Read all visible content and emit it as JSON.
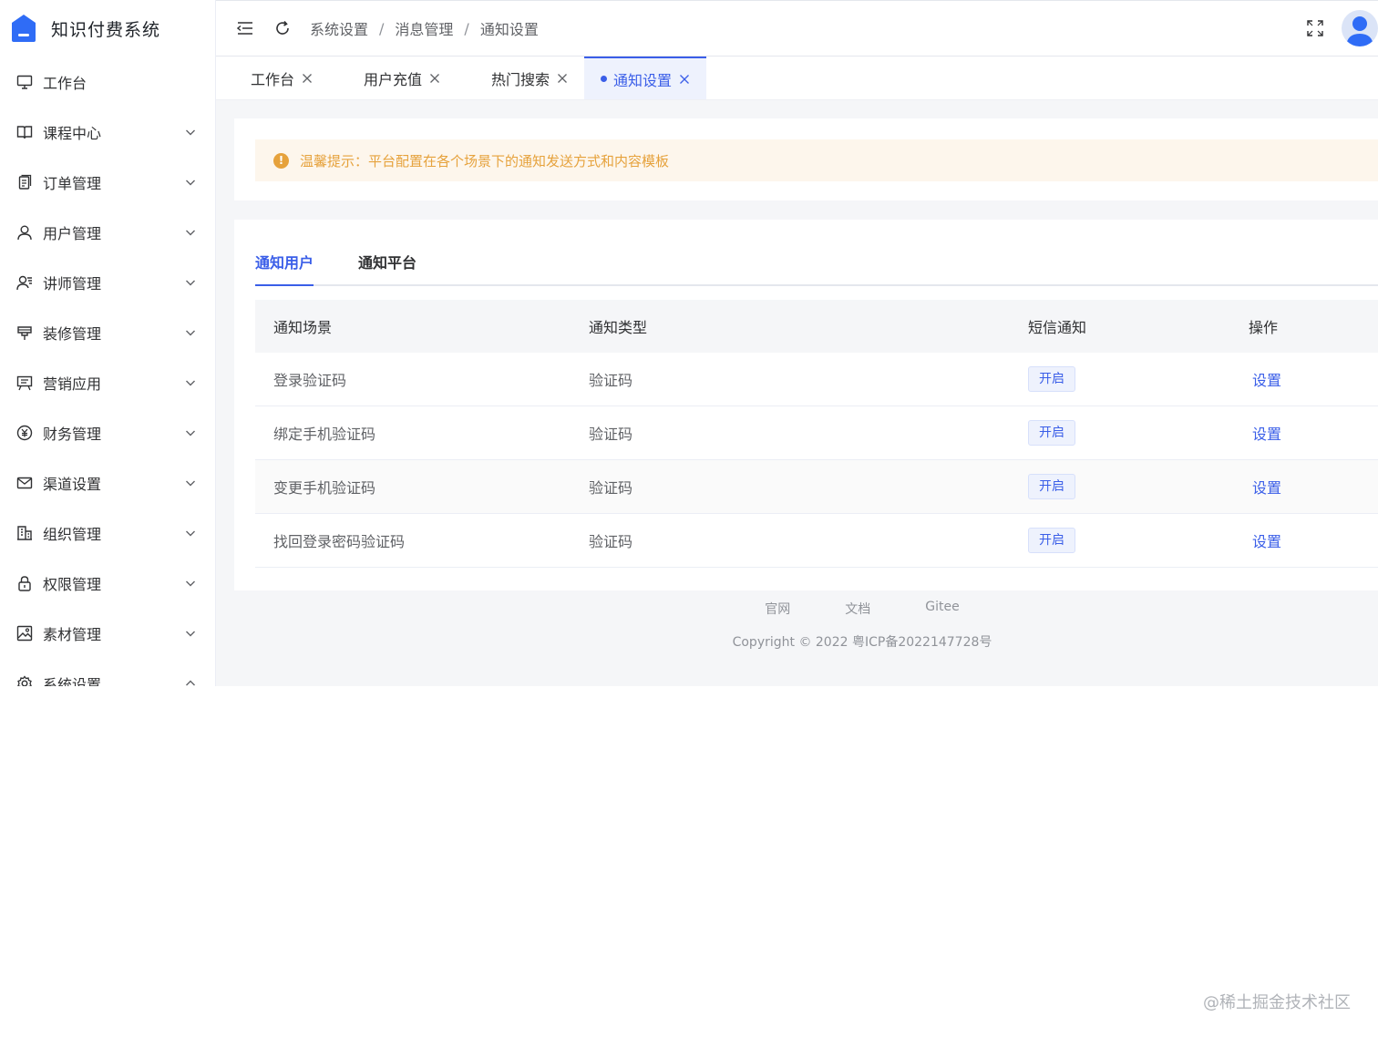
{
  "app": {
    "title": "知识付费系统"
  },
  "sidebar": {
    "items": [
      {
        "label": "工作台",
        "icon": "monitor-icon",
        "has_arrow": false
      },
      {
        "label": "课程中心",
        "icon": "book-icon",
        "has_arrow": true
      },
      {
        "label": "订单管理",
        "icon": "order-icon",
        "has_arrow": true
      },
      {
        "label": "用户管理",
        "icon": "user-icon",
        "has_arrow": true
      },
      {
        "label": "讲师管理",
        "icon": "teacher-icon",
        "has_arrow": true
      },
      {
        "label": "装修管理",
        "icon": "decoration-icon",
        "has_arrow": true
      },
      {
        "label": "营销应用",
        "icon": "marketing-icon",
        "has_arrow": true
      },
      {
        "label": "财务管理",
        "icon": "finance-icon",
        "has_arrow": true
      },
      {
        "label": "渠道设置",
        "icon": "mail-icon",
        "has_arrow": true
      },
      {
        "label": "组织管理",
        "icon": "organization-icon",
        "has_arrow": true
      },
      {
        "label": "权限管理",
        "icon": "lock-icon",
        "has_arrow": true
      },
      {
        "label": "素材管理",
        "icon": "picture-icon",
        "has_arrow": true
      },
      {
        "label": "系统设置",
        "icon": "gear-icon",
        "has_arrow": true
      }
    ]
  },
  "header": {
    "breadcrumb": [
      "系统设置",
      "消息管理",
      "通知设置"
    ],
    "separator": "/"
  },
  "tabs": [
    {
      "label": "工作台",
      "active": false
    },
    {
      "label": "用户充值",
      "active": false
    },
    {
      "label": "热门搜索",
      "active": false
    },
    {
      "label": "通知设置",
      "active": true
    }
  ],
  "alert": {
    "text": "温馨提示：平台配置在各个场景下的通知发送方式和内容模板"
  },
  "sub_tabs": [
    {
      "label": "通知用户",
      "active": true
    },
    {
      "label": "通知平台",
      "active": false
    }
  ],
  "table": {
    "columns": [
      "通知场景",
      "通知类型",
      "短信通知",
      "操作"
    ],
    "rows": [
      {
        "scene": "登录验证码",
        "type": "验证码",
        "sms": "开启",
        "action": "设置"
      },
      {
        "scene": "绑定手机验证码",
        "type": "验证码",
        "sms": "开启",
        "action": "设置"
      },
      {
        "scene": "变更手机验证码",
        "type": "验证码",
        "sms": "开启",
        "action": "设置"
      },
      {
        "scene": "找回登录密码验证码",
        "type": "验证码",
        "sms": "开启",
        "action": "设置"
      }
    ]
  },
  "footer": {
    "links": [
      "官网",
      "文档",
      "Gitee"
    ],
    "copyright": "Copyright © 2022 粤ICP备2022147728号"
  },
  "watermark": "@稀土掘金技术社区",
  "colors": {
    "primary": "#3a5ee8",
    "warning": "#e6a23c"
  }
}
